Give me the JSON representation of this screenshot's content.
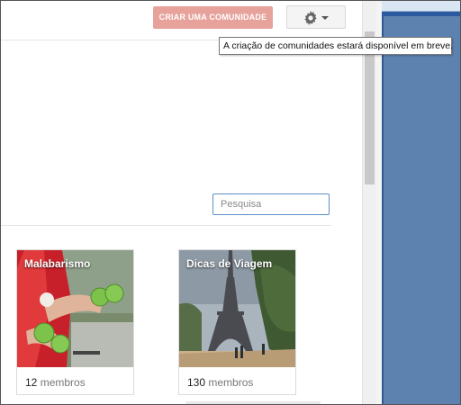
{
  "header": {
    "create_button_label": "CRIAR UMA COMUNIDADE",
    "settings_button": {
      "icon": "gear-icon",
      "dropdown_icon": "caret-down-icon"
    }
  },
  "tooltip": {
    "text": "A criação de comunidades estará disponível em breve."
  },
  "search": {
    "placeholder": "Pesquisa",
    "value": ""
  },
  "communities": [
    {
      "name": "Malabarismo",
      "member_count": "12",
      "member_label": "membros"
    },
    {
      "name": "Dicas de Viagem",
      "member_count": "130",
      "member_label": "membros"
    }
  ],
  "colors": {
    "create_button": "#e6a29b",
    "search_border": "#5b8ec9",
    "side_panel": "#5e82b0"
  }
}
